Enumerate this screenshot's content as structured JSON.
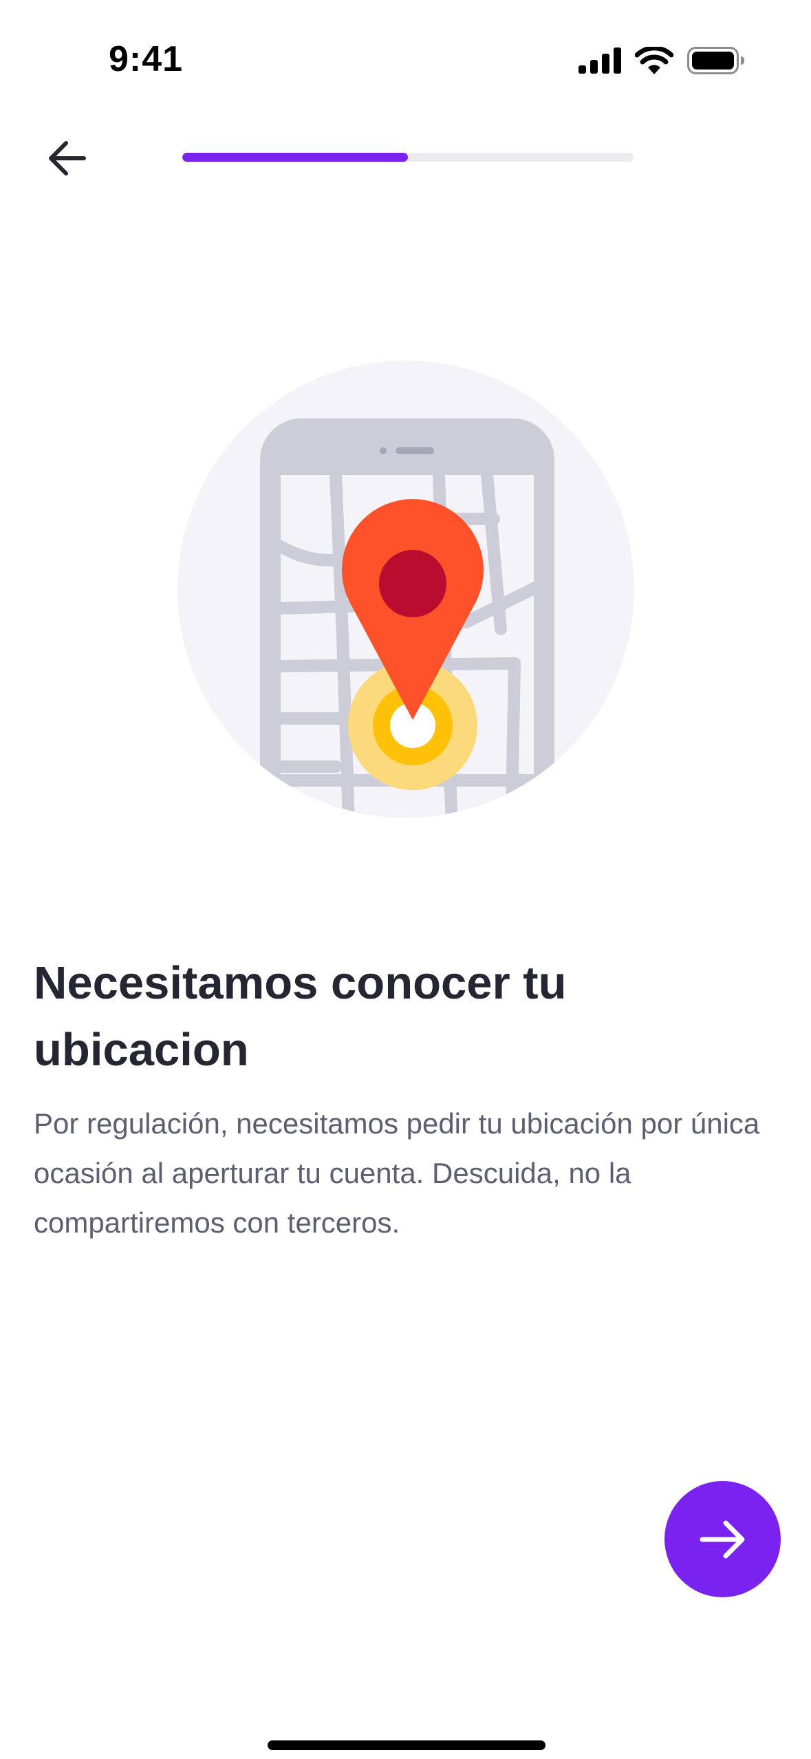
{
  "status_bar": {
    "time": "9:41",
    "icons": [
      "cellular-signal-icon",
      "wifi-icon",
      "battery-icon"
    ]
  },
  "header": {
    "back_icon": "arrow-left-icon",
    "progress": 0.5
  },
  "illustration": {
    "icon": "location-pin-on-phone-map-icon"
  },
  "content": {
    "title": "Necesitamos conocer tu ubicacion",
    "description": "Por regulación, necesitamos pedir tu ubicación por única ocasión al aperturar tu cuenta. Descuida, no la compartiremos con terceros."
  },
  "next_button": {
    "icon": "arrow-right-icon"
  },
  "colors": {
    "accent": "#7A22F0",
    "pin": "#FF512A",
    "pin_center": "#B90C2F",
    "marker_yellow": "#FFC107",
    "marker_halo": "#FCD97B",
    "map_lines": "#CDCDD9",
    "illustration_bg": "#F3F3F8",
    "title": "#262633",
    "body_text": "#5E5E72"
  }
}
